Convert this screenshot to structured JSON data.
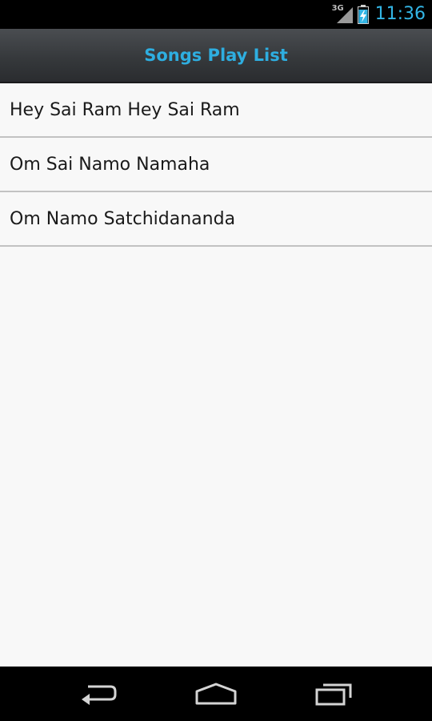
{
  "status_bar": {
    "network_label": "3G",
    "time": "11:36",
    "icons": [
      "signal-icon",
      "battery-charging-icon"
    ],
    "time_color": "#33b5e5"
  },
  "action_bar": {
    "title": "Songs Play List",
    "title_color": "#2eaee0"
  },
  "songs": [
    {
      "label": "Hey Sai Ram Hey Sai Ram"
    },
    {
      "label": "Om Sai Namo Namaha"
    },
    {
      "label": "Om Namo Satchidananda"
    }
  ],
  "nav_bar": {
    "buttons": [
      "back-icon",
      "home-icon",
      "recent-apps-icon"
    ]
  }
}
